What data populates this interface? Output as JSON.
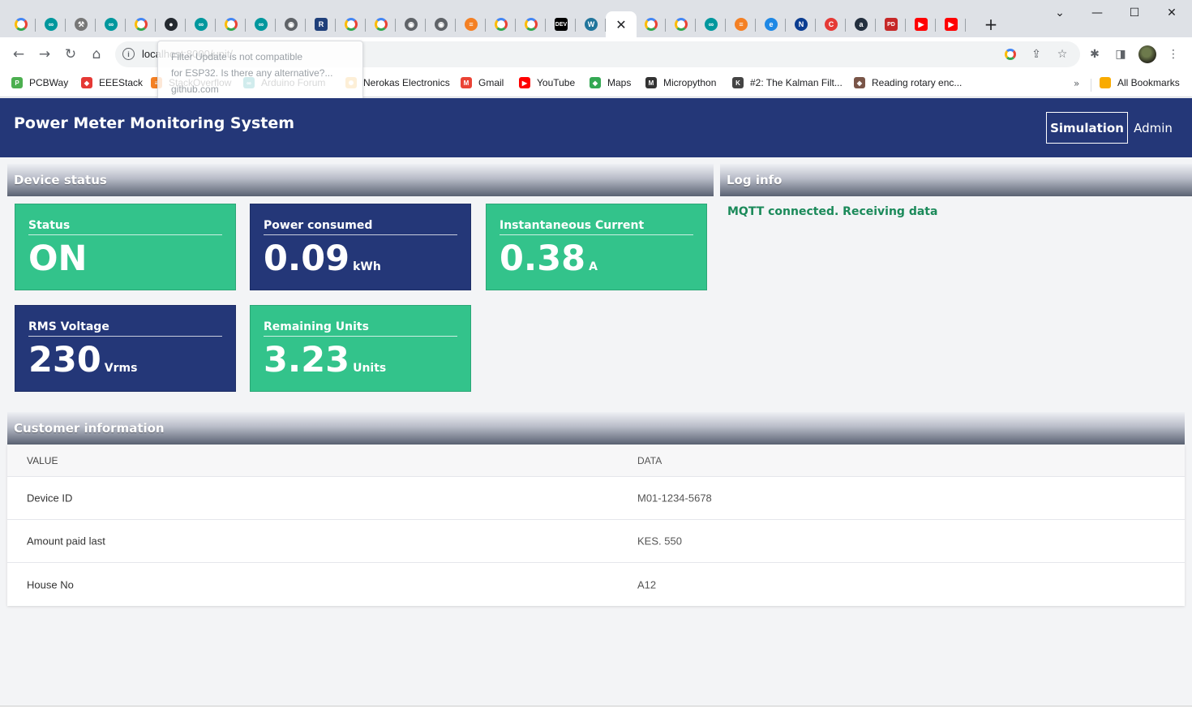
{
  "browser": {
    "tabs": [
      {
        "icon": "google-icon"
      },
      {
        "icon": "arduino-icon"
      },
      {
        "icon": "tool-icon"
      },
      {
        "icon": "arduino-icon"
      },
      {
        "icon": "google-icon"
      },
      {
        "icon": "github-icon"
      },
      {
        "icon": "arduino-icon"
      },
      {
        "icon": "google-icon"
      },
      {
        "icon": "arduino-icon"
      },
      {
        "icon": "globe-icon"
      },
      {
        "icon": "r-icon"
      },
      {
        "icon": "google-icon"
      },
      {
        "icon": "google-icon"
      },
      {
        "icon": "globe-icon"
      },
      {
        "icon": "globe-icon"
      },
      {
        "icon": "stackoverflow-icon"
      },
      {
        "icon": "google-icon"
      },
      {
        "icon": "google-icon"
      },
      {
        "icon": "dev-icon"
      },
      {
        "icon": "wordpress-icon"
      },
      {
        "icon": "close-icon",
        "active": true
      },
      {
        "icon": "google-icon"
      },
      {
        "icon": "google-icon"
      },
      {
        "icon": "arduino-icon"
      },
      {
        "icon": "stackoverflow-icon"
      },
      {
        "icon": "edge-icon"
      },
      {
        "icon": "nasa-icon"
      },
      {
        "icon": "c-icon"
      },
      {
        "icon": "amazon-icon"
      },
      {
        "icon": "pd-icon"
      },
      {
        "icon": "youtube-icon"
      },
      {
        "icon": "youtube-icon"
      }
    ],
    "new_tab_label": "+",
    "url": "localhost:8000/unit/",
    "tooltip": {
      "line1": "Filter Update is not compatible",
      "line2": "for ESP32. Is there any alternative?...",
      "line3": "github.com"
    },
    "bookmarks": [
      {
        "label": "PCBWay",
        "icon": "pcbway-icon",
        "color": "#4caf50"
      },
      {
        "label": "EEEStack",
        "icon": "eeestack-icon",
        "color": "#e53935"
      },
      {
        "label": "StackOverflow",
        "icon": "stackoverflow-icon",
        "color": "#f48024"
      },
      {
        "label": "Arduino Forum",
        "icon": "arduino-icon",
        "color": "#00979d"
      },
      {
        "label": "Nerokas Electronics",
        "icon": "nerokas-icon",
        "color": "#f5a623"
      },
      {
        "label": "Gmail",
        "icon": "gmail-icon",
        "color": "#ea4335"
      },
      {
        "label": "YouTube",
        "icon": "youtube-icon",
        "color": "#ff0000"
      },
      {
        "label": "Maps",
        "icon": "maps-icon",
        "color": "#34a853"
      },
      {
        "label": "Micropython",
        "icon": "micropython-icon",
        "color": "#333333"
      },
      {
        "label": "#2: The Kalman Filt...",
        "icon": "kalman-icon",
        "color": "#444444"
      },
      {
        "label": "Reading rotary enc...",
        "icon": "rotary-icon",
        "color": "#795548"
      }
    ],
    "bookmarks_overflow": "»",
    "all_bookmarks": "All Bookmarks"
  },
  "app": {
    "title": "Power Meter Monitoring System",
    "nav": {
      "simulation": "Simulation",
      "admin": "Admin"
    }
  },
  "device_status": {
    "heading": "Device status",
    "cards": [
      {
        "title": "Status",
        "value": "ON",
        "unit": "",
        "color": "#33c38b"
      },
      {
        "title": "Power consumed",
        "value": "0.09",
        "unit": "kWh",
        "color": "#243778"
      },
      {
        "title": "Instantaneous Current",
        "value": "0.38",
        "unit": "A",
        "color": "#33c38b"
      },
      {
        "title": "RMS Voltage",
        "value": "230",
        "unit": "Vrms",
        "color": "#243778"
      },
      {
        "title": "Remaining Units",
        "value": "3.23",
        "unit": "Units",
        "color": "#33c38b"
      }
    ]
  },
  "log": {
    "heading": "Log info",
    "message": "MQTT connected. Receiving data"
  },
  "customer": {
    "heading": "Customer information",
    "columns": [
      "VALUE",
      "DATA"
    ],
    "rows": [
      [
        "Device ID",
        "M01-1234-5678"
      ],
      [
        "Amount paid last",
        "KES. 550"
      ],
      [
        "House No",
        "A12"
      ]
    ]
  }
}
